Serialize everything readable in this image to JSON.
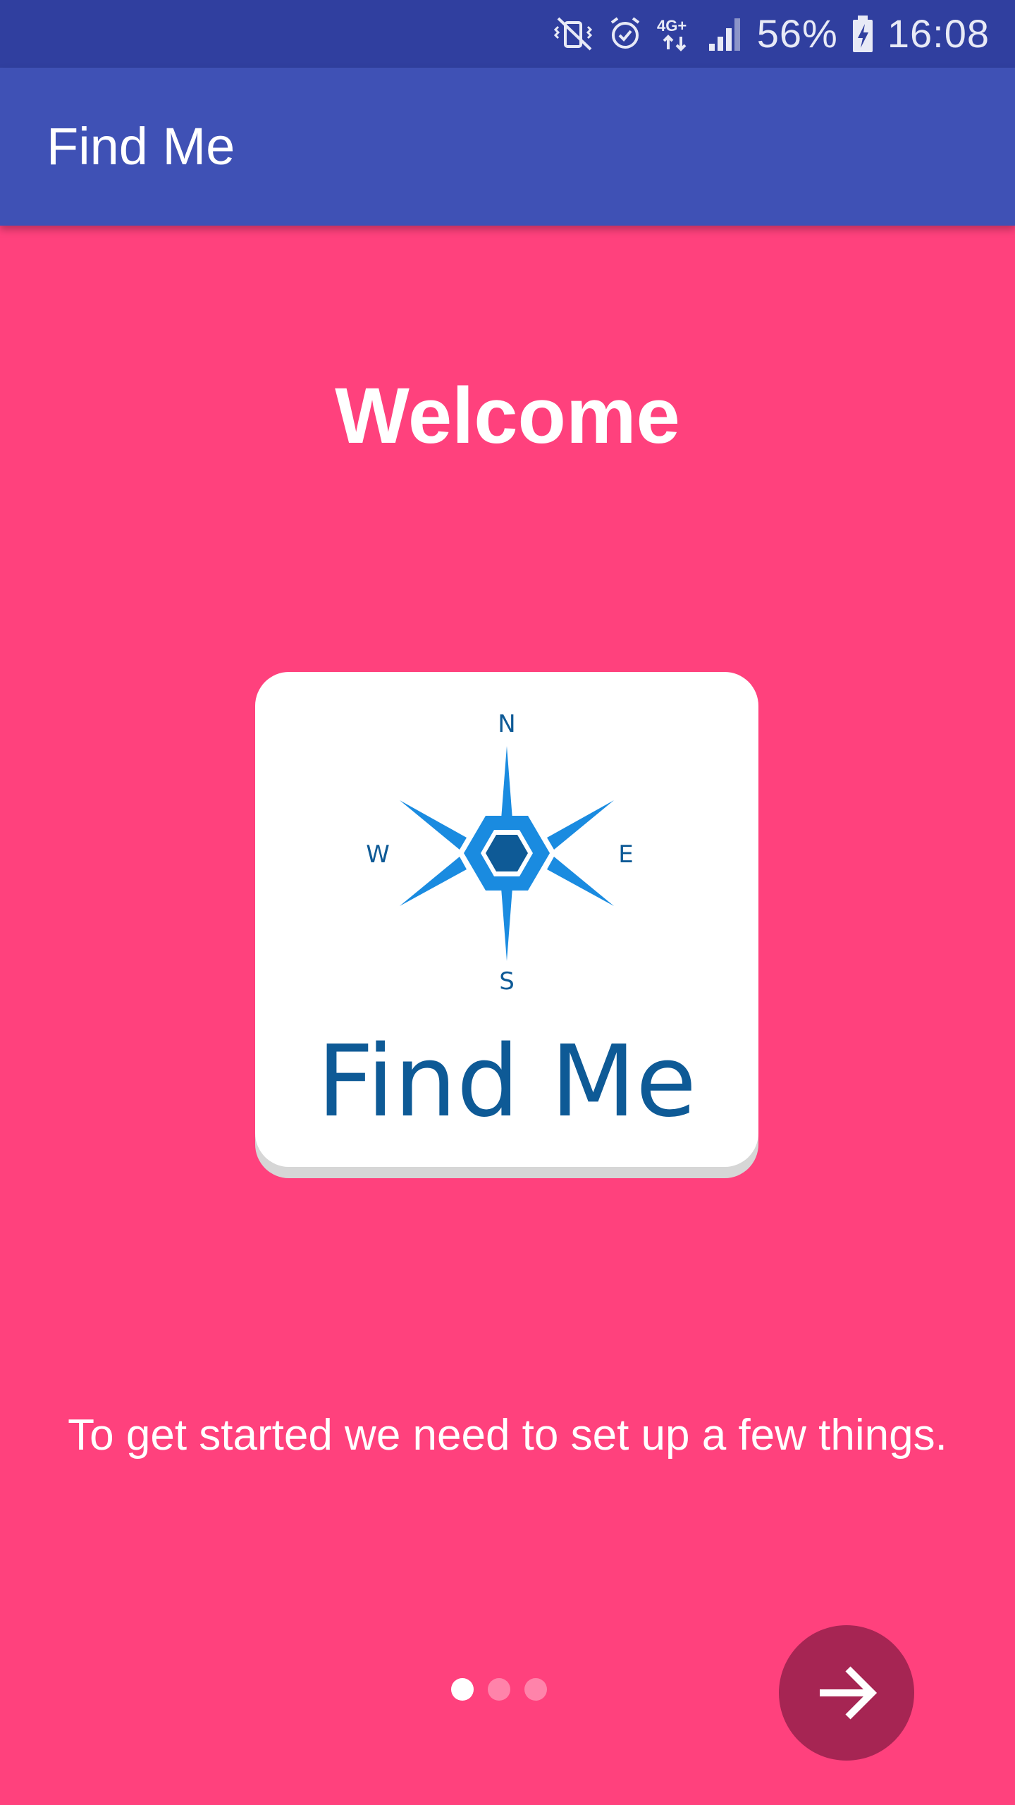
{
  "status_bar": {
    "battery_percent": "56%",
    "time": "16:08",
    "network_label": "4G+",
    "icons": [
      "vibrate-mute-icon",
      "alarm-icon",
      "network-4g-icon",
      "signal-icon",
      "battery-charging-icon"
    ]
  },
  "app_bar": {
    "title": "Find Me"
  },
  "main": {
    "heading": "Welcome",
    "logo": {
      "text": "Find Me",
      "compass_n": "N",
      "compass_e": "E",
      "compass_s": "S",
      "compass_w": "W"
    },
    "tagline": "To get started we need to set up a few things."
  },
  "pager": {
    "count": 3,
    "active_index": 0
  },
  "next_button": {
    "icon": "arrow-right-icon"
  },
  "colors": {
    "status_bar": "#303F9F",
    "app_bar": "#3F51B5",
    "background": "#FF417D",
    "next_button": "#A62553",
    "logo_blue": "#0E5A96",
    "compass_blue": "#1A8BE0"
  }
}
